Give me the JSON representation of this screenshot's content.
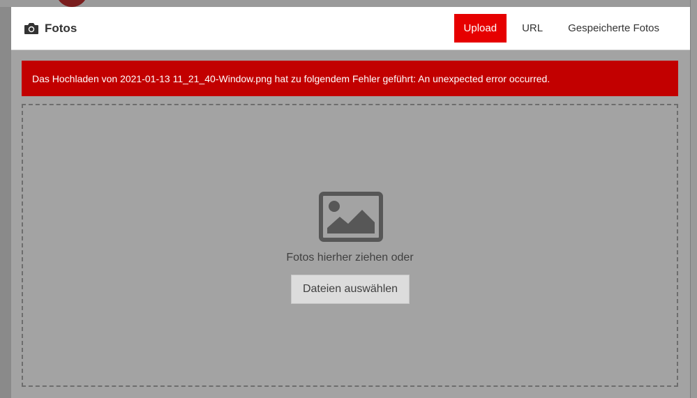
{
  "modal": {
    "title": "Fotos",
    "tabs": [
      {
        "label": "Upload",
        "active": true
      },
      {
        "label": "URL",
        "active": false
      },
      {
        "label": "Gespeicherte Fotos",
        "active": false
      }
    ],
    "error_message": "Das Hochladen von 2021-01-13 11_21_40-Window.png hat zu folgendem Fehler geführt: An unexpected error occurred.",
    "dropzone": {
      "hint": "Fotos hierher ziehen oder",
      "button_label": "Dateien auswählen"
    }
  },
  "icons": {
    "title_icon": "camera-icon",
    "dropzone_icon": "image-icon"
  },
  "colors": {
    "accent": "#e60000",
    "error": "#c20000",
    "overlay": "#a3a3a3"
  }
}
